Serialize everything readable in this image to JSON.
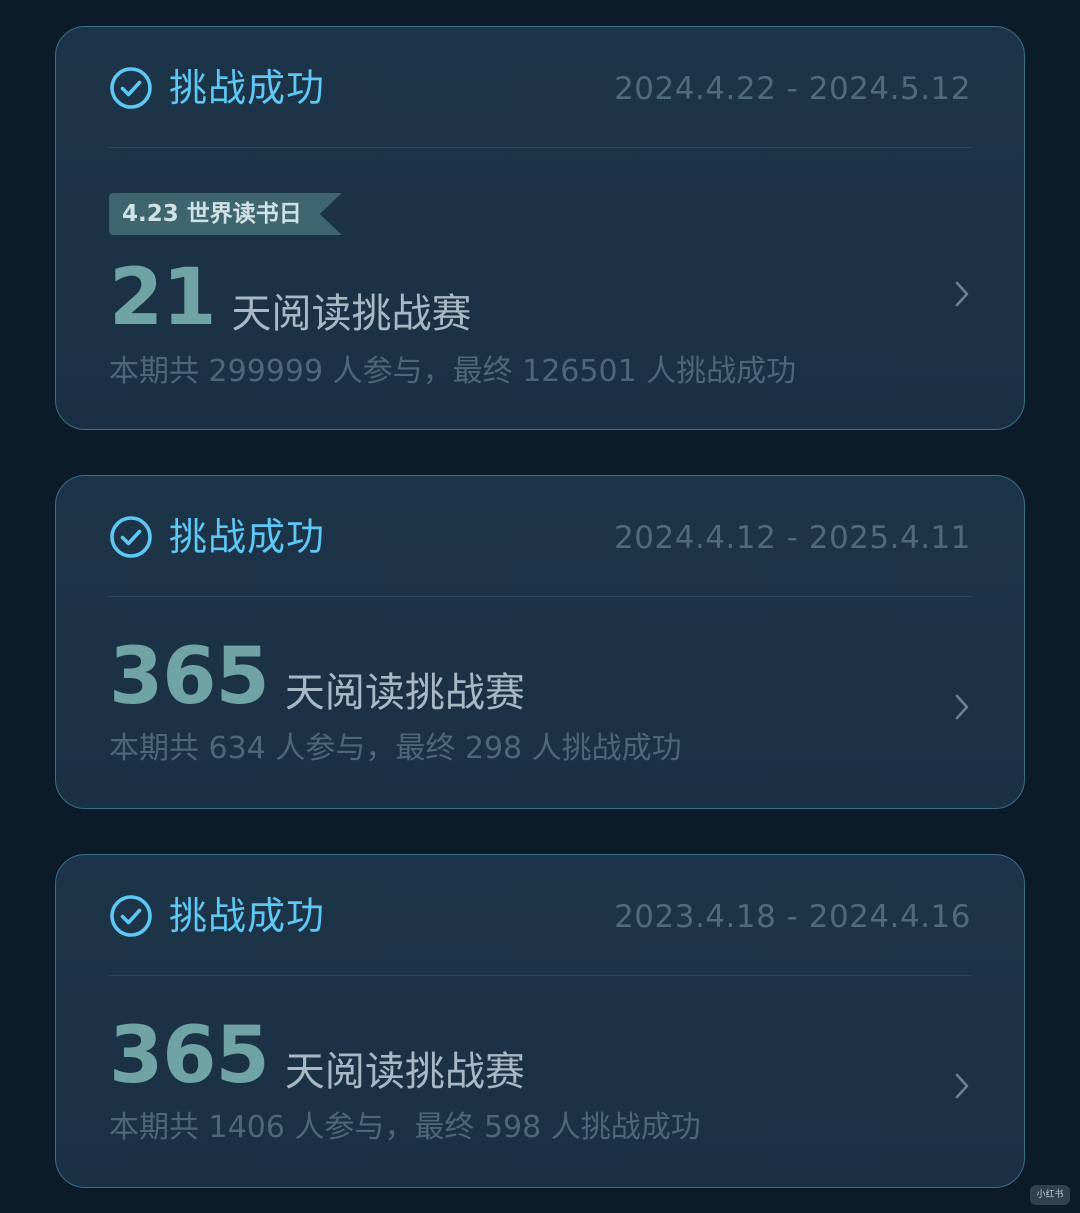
{
  "cards": [
    {
      "status": "挑战成功",
      "date_range": "2024.4.22 - 2024.5.12",
      "tag": "4.23 世界读书日",
      "days": "21",
      "title": "天阅读挑战赛",
      "stats": "本期共 299999 人参与，最终 126501 人挑战成功"
    },
    {
      "status": "挑战成功",
      "date_range": "2024.4.12 - 2025.4.11",
      "days": "365",
      "title": "天阅读挑战赛",
      "stats": "本期共 634 人参与，最终 298 人挑战成功"
    },
    {
      "status": "挑战成功",
      "date_range": "2023.4.18 - 2024.4.16",
      "days": "365",
      "title": "天阅读挑战赛",
      "stats": "本期共 1406 人参与，最终 598 人挑战成功"
    }
  ],
  "watermark": "小红书",
  "icons": {
    "status": "check-circle-icon",
    "navigate": "chevron-right-icon"
  },
  "colors": {
    "background": "#0c1b2a",
    "card": "#1b3246",
    "card_border": "#3a6f86",
    "accent": "#5ec7f4",
    "days_number": "#6fa3a5",
    "tag_background": "#3f6570"
  }
}
